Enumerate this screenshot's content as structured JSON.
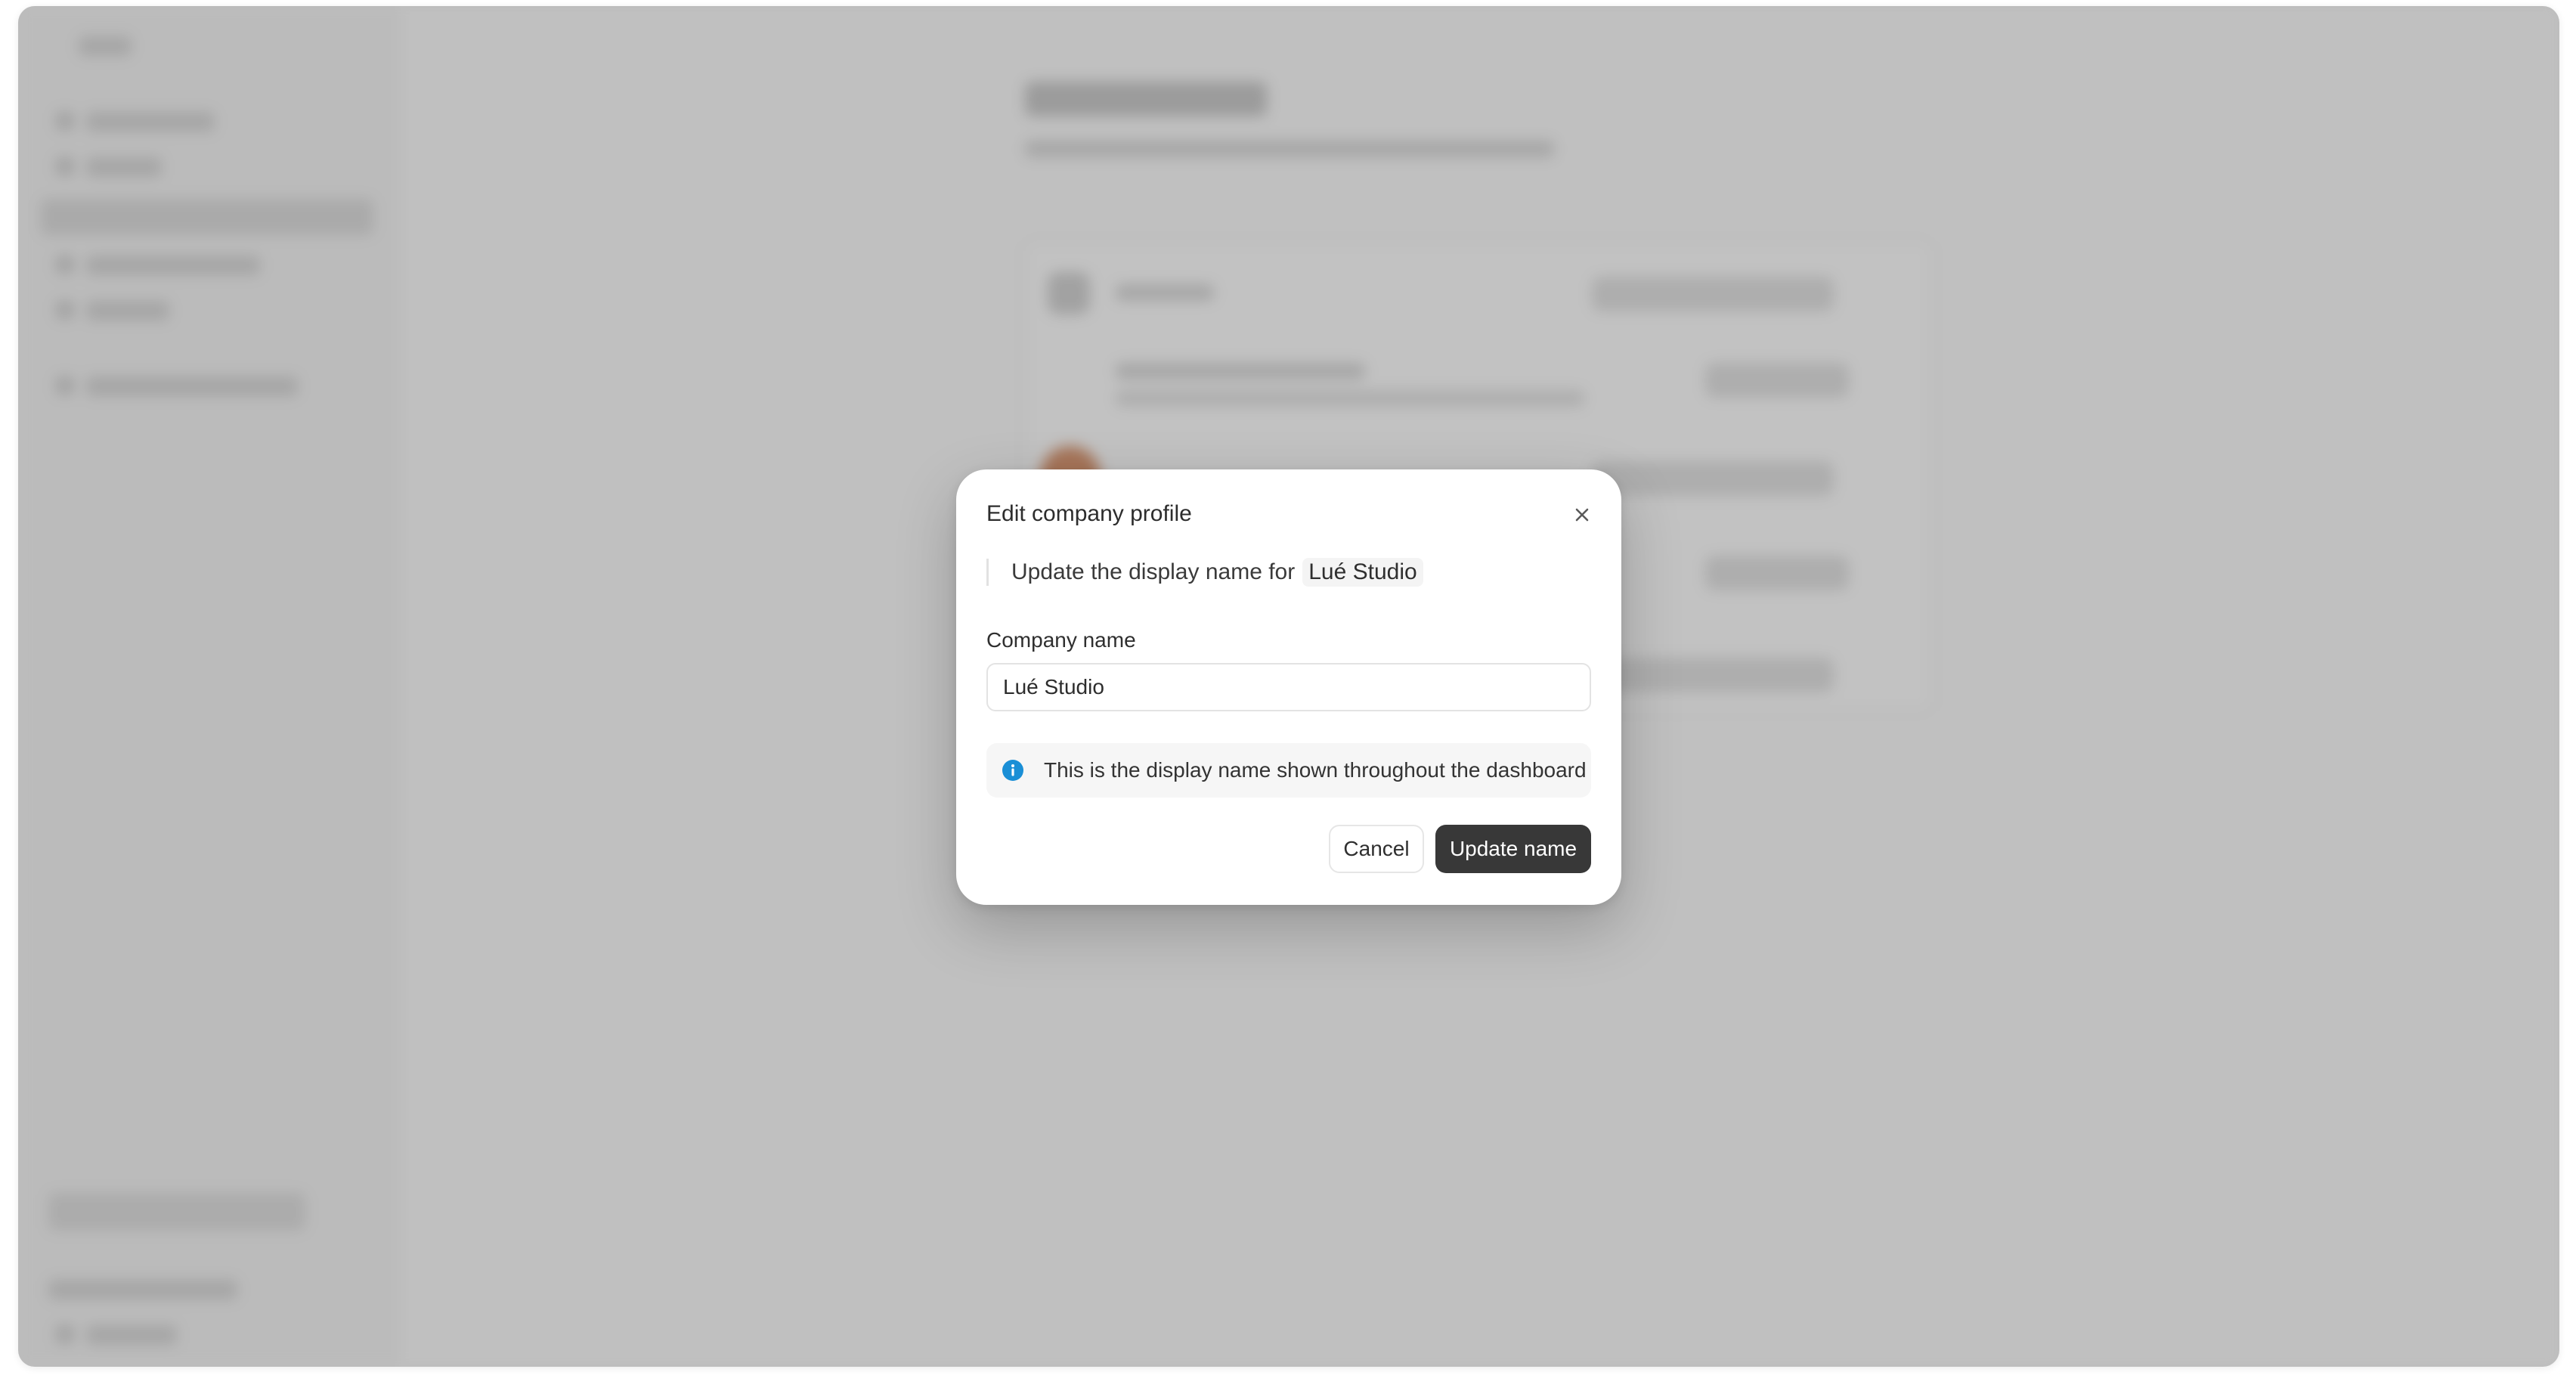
{
  "modal": {
    "title": "Edit company profile",
    "subtitle_prefix": "Update the display name for",
    "subtitle_company": "Lué Studio",
    "field_label": "Company name",
    "field_value": "Lué Studio",
    "info_text": "This is the display name shown throughout the dashboard",
    "cancel_label": "Cancel",
    "submit_label": "Update name"
  },
  "icons": {
    "close": "close-icon",
    "info": "info-icon"
  },
  "colors": {
    "primary_button": "#383838",
    "info_icon": "#1a8fd6",
    "overlay": "rgba(110,110,110,0.42)"
  }
}
